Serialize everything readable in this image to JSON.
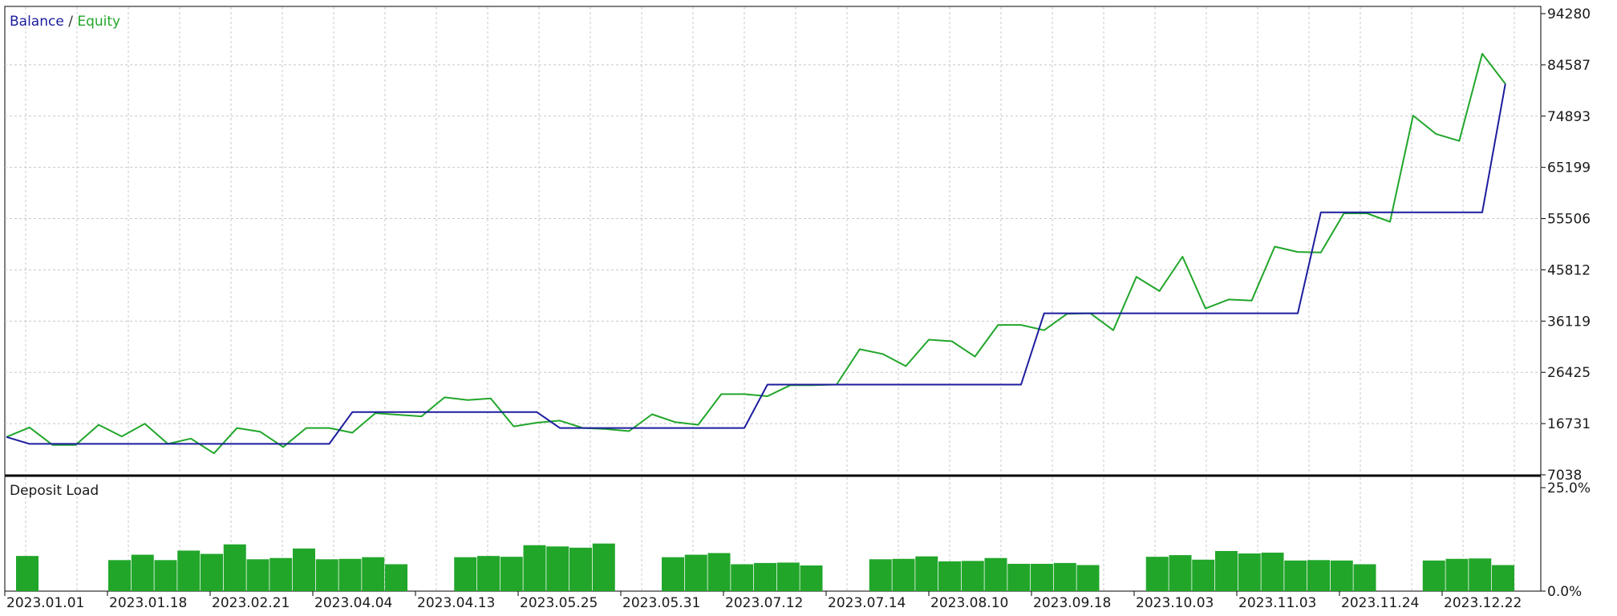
{
  "chart_data": [
    {
      "type": "line",
      "legend": {
        "balance": "Balance",
        "separator": " / ",
        "equity": "Equity"
      },
      "legend_placement": "top-left",
      "grid": true,
      "y_ticks": [
        "94280",
        "84587",
        "74893",
        "65199",
        "55506",
        "45812",
        "36119",
        "26425",
        "16731",
        "7038"
      ],
      "ylim": [
        7038,
        94280
      ],
      "x_ticks": [
        "2023.01.01",
        "2023.01.18",
        "2023.02.21",
        "2023.04.04",
        "2023.04.13",
        "2023.05.25",
        "2023.05.31",
        "2023.07.12",
        "2023.07.14",
        "2023.08.10",
        "2023.09.18",
        "2023.10.03",
        "2023.11.03",
        "2023.11.24",
        "2023.12.22"
      ],
      "x_count": 67,
      "series": [
        {
          "name": "Balance",
          "color": "#1c1c9e",
          "points": [
            [
              0,
              14200
            ],
            [
              1,
              12900
            ],
            [
              14,
              12900
            ],
            [
              15,
              18900
            ],
            [
              23,
              18900
            ],
            [
              24,
              15900
            ],
            [
              32,
              15900
            ],
            [
              33,
              24100
            ],
            [
              44,
              24100
            ],
            [
              45,
              37600
            ],
            [
              56,
              37600
            ],
            [
              57,
              56700
            ],
            [
              64,
              56700
            ],
            [
              65,
              81000
            ]
          ]
        },
        {
          "name": "Equity",
          "color": "#21a62a",
          "points": [
            [
              0,
              14200
            ],
            [
              1,
              16000
            ],
            [
              2,
              12700
            ],
            [
              3,
              12700
            ],
            [
              4,
              16500
            ],
            [
              5,
              14300
            ],
            [
              6,
              16700
            ],
            [
              7,
              12900
            ],
            [
              8,
              13900
            ],
            [
              9,
              11100
            ],
            [
              10,
              15900
            ],
            [
              11,
              15200
            ],
            [
              12,
              12300
            ],
            [
              13,
              15900
            ],
            [
              14,
              15900
            ],
            [
              15,
              15000
            ],
            [
              16,
              18700
            ],
            [
              17,
              18400
            ],
            [
              18,
              18100
            ],
            [
              19,
              21700
            ],
            [
              20,
              21200
            ],
            [
              21,
              21500
            ],
            [
              22,
              16200
            ],
            [
              23,
              16900
            ],
            [
              24,
              17300
            ],
            [
              25,
              15900
            ],
            [
              26,
              15700
            ],
            [
              27,
              15300
            ],
            [
              28,
              18500
            ],
            [
              29,
              17000
            ],
            [
              30,
              16500
            ],
            [
              31,
              22300
            ],
            [
              32,
              22300
            ],
            [
              33,
              21900
            ],
            [
              34,
              24000
            ],
            [
              35,
              24000
            ],
            [
              36,
              24100
            ],
            [
              37,
              30800
            ],
            [
              38,
              29900
            ],
            [
              39,
              27600
            ],
            [
              40,
              32600
            ],
            [
              41,
              32300
            ],
            [
              42,
              29400
            ],
            [
              43,
              35400
            ],
            [
              44,
              35400
            ],
            [
              45,
              34400
            ],
            [
              46,
              37500
            ],
            [
              47,
              37600
            ],
            [
              48,
              34400
            ],
            [
              49,
              44500
            ],
            [
              50,
              41800
            ],
            [
              51,
              48300
            ],
            [
              52,
              38500
            ],
            [
              53,
              40200
            ],
            [
              54,
              40000
            ],
            [
              55,
              50200
            ],
            [
              56,
              49200
            ],
            [
              57,
              49100
            ],
            [
              58,
              56500
            ],
            [
              59,
              56500
            ],
            [
              60,
              54900
            ],
            [
              61,
              75000
            ],
            [
              62,
              71500
            ],
            [
              63,
              70200
            ],
            [
              64,
              86700
            ],
            [
              65,
              81000
            ]
          ]
        }
      ]
    },
    {
      "type": "bar",
      "title": "Deposit Load",
      "y_ticks": [
        "25.0%",
        "0.0%"
      ],
      "ylim": [
        0,
        25
      ],
      "color": "#21a62a",
      "values": [
        8.5,
        0,
        0,
        0,
        7.5,
        8.8,
        7.5,
        9.8,
        9.0,
        11.3,
        7.7,
        8.0,
        10.3,
        7.7,
        7.8,
        8.2,
        6.5,
        0,
        0,
        8.2,
        8.5,
        8.3,
        11.1,
        10.8,
        10.5,
        11.5,
        0,
        0,
        8.2,
        8.8,
        9.2,
        6.5,
        6.8,
        6.9,
        6.2,
        0,
        0,
        7.7,
        7.8,
        8.4,
        7.2,
        7.3,
        8.0,
        6.6,
        6.6,
        6.8,
        6.3,
        0,
        0,
        8.3,
        8.7,
        7.6,
        9.7,
        9.1,
        9.3,
        7.4,
        7.5,
        7.4,
        6.5,
        0,
        0,
        7.4,
        7.8,
        7.9,
        6.3
      ]
    }
  ]
}
